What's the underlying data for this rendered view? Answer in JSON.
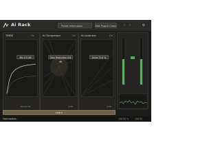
{
  "header": {
    "title": "Ai Rack",
    "preset": "Preset Information",
    "save_label": "Edit Plug-in Chain",
    "icons": [
      "chevron-left-icon",
      "chevron-right-icon",
      "settings-icon"
    ]
  },
  "panels": [
    {
      "title": "TIMBE",
      "sub": "On",
      "control": "Mix  0.5 dB",
      "foot_left": "400.00 Hz",
      "foot_right": "0.00"
    },
    {
      "title": "AI Compressor",
      "sub": "On",
      "control": "Gain Reduction  0.8 dB",
      "foot_left": "",
      "foot_right": "0.00"
    },
    {
      "title": "AI Loudness",
      "sub": "On",
      "control": "Drive  72.8 %",
      "foot_left": "",
      "foot_right": "0.00"
    }
  ],
  "learn_label": "Learn",
  "status": {
    "left": "Optimization",
    "right": [
      "100.00 %",
      "100.00"
    ]
  },
  "meters": {
    "left_level": 0.55,
    "right_level": 0.55,
    "accent": "#59b35c"
  },
  "colors": {
    "background": "#1c1c1a",
    "learn_button": "#6b6149",
    "accent_gold": "#c8b27a"
  }
}
